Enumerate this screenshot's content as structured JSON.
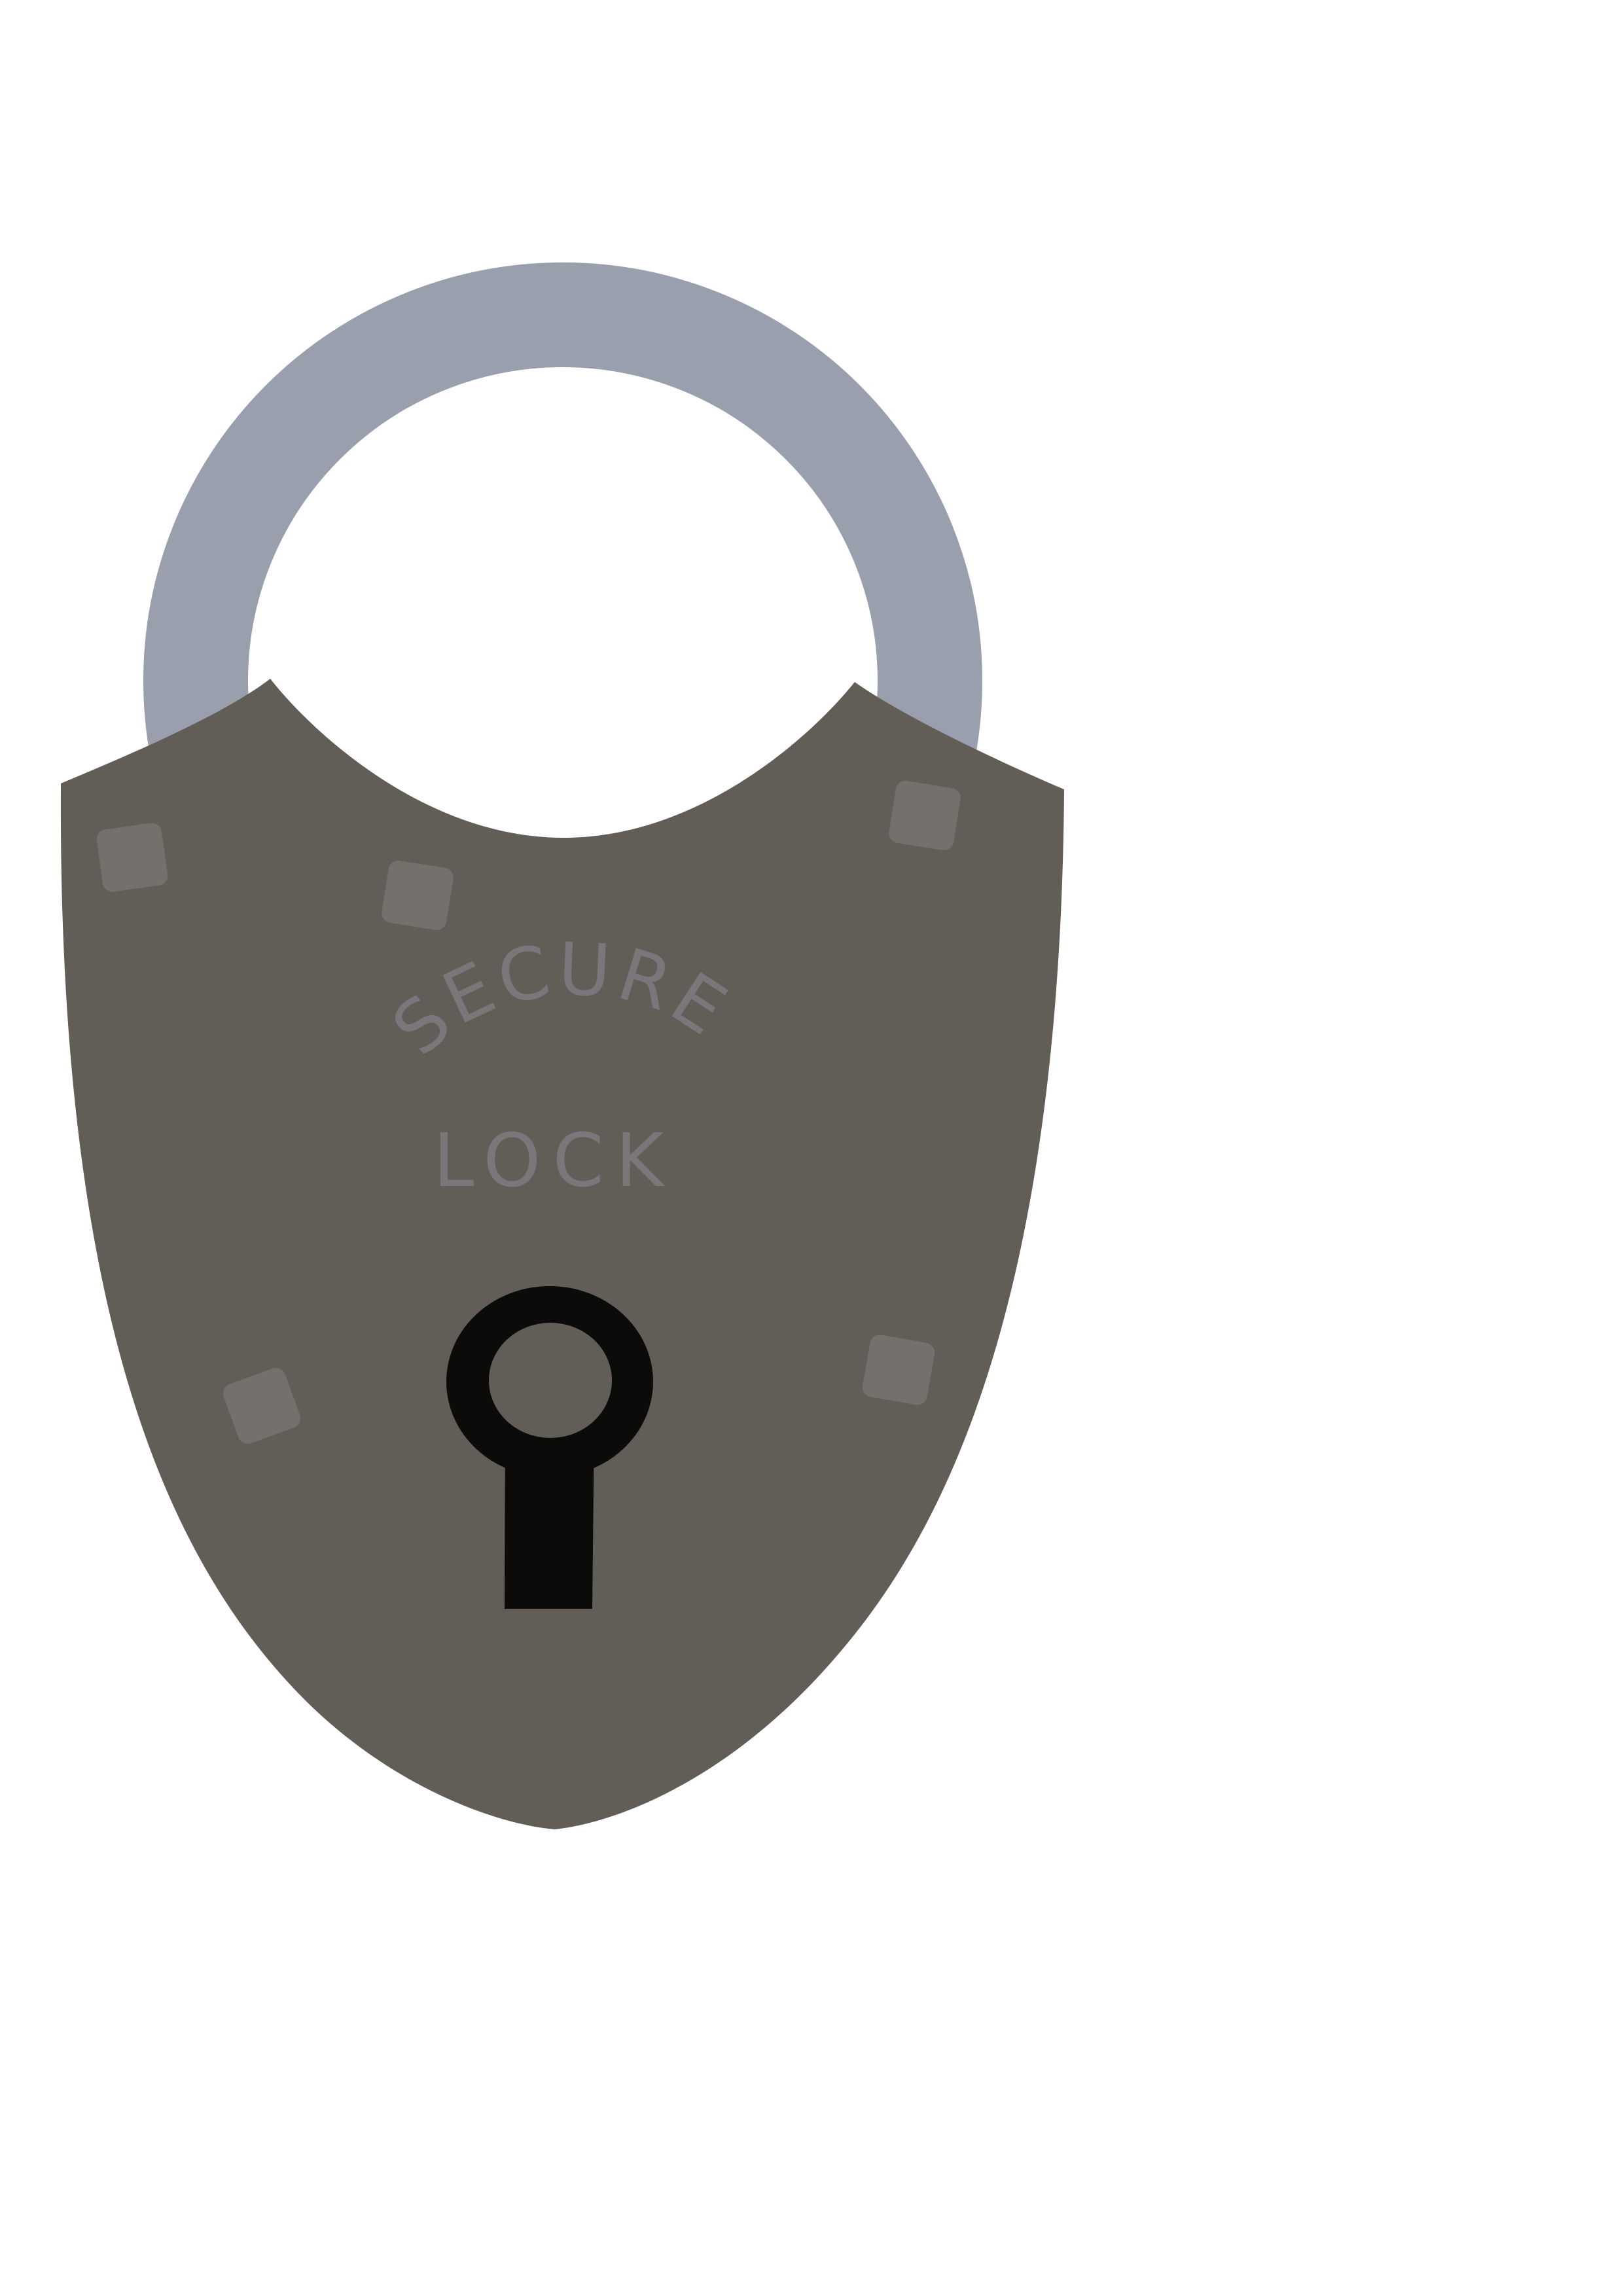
{
  "lock": {
    "arc_text": "SECURE",
    "label_text": "LOCK"
  },
  "colors": {
    "background": "#ffffff",
    "shackle": "#9a9fae",
    "body": "#625d57",
    "rivet": "#75706c",
    "text": "#7a7679",
    "keyhole": "#0b0b09",
    "keyhole_center": "#625d57"
  },
  "icons": {
    "main": "padlock-icon",
    "keyhole": "keyhole-icon"
  }
}
